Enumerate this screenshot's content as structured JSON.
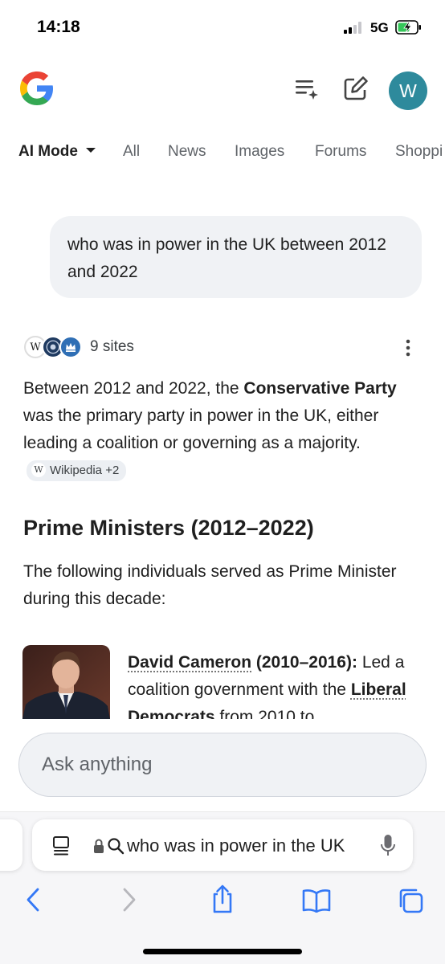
{
  "status_bar": {
    "time": "14:18",
    "network": "5G"
  },
  "header": {
    "avatar_initial": "W"
  },
  "tabs": [
    {
      "label": "AI Mode"
    },
    {
      "label": "All"
    },
    {
      "label": "News"
    },
    {
      "label": "Images"
    },
    {
      "label": "Forums"
    },
    {
      "label": "Shoppi"
    }
  ],
  "query": {
    "text": "who was in power in the UK between 2012 and 2022"
  },
  "sources": {
    "count_label": "9 sites"
  },
  "answer": {
    "p1_before": "Between 2012 and 2022, the ",
    "p1_bold": "Conservative Party",
    "p1_after": " was the primary party in power in the UK, either leading a coalition or governing as a majority.",
    "citation_label": "Wikipedia +2",
    "citation_icon": "W",
    "heading": "Prime Ministers (2012–2022)",
    "intro": "The following individuals served as Prime Minister during this decade:",
    "pm_items": [
      {
        "name": "David Cameron",
        "years": " (2010–2016):",
        "desc_before": " Led a coalition government with the ",
        "desc_bold": "Liberal Democrats",
        "desc_after": " from 2010 to"
      }
    ]
  },
  "ask_bar": {
    "placeholder": "Ask anything"
  },
  "safari": {
    "address_text": "who was in power in the UK"
  },
  "colors": {
    "avatar": "#2e8a9c",
    "safari_blue": "#3478f6",
    "bubble": "#f0f2f5"
  },
  "icons": [
    "google-logo-icon",
    "history-icon",
    "new-chat-icon",
    "more-vert-icon",
    "wikipedia-icon",
    "reader-icon",
    "lock-icon",
    "search-icon",
    "mic-icon",
    "back-icon",
    "forward-icon",
    "share-icon",
    "bookmarks-icon",
    "tabs-icon"
  ]
}
